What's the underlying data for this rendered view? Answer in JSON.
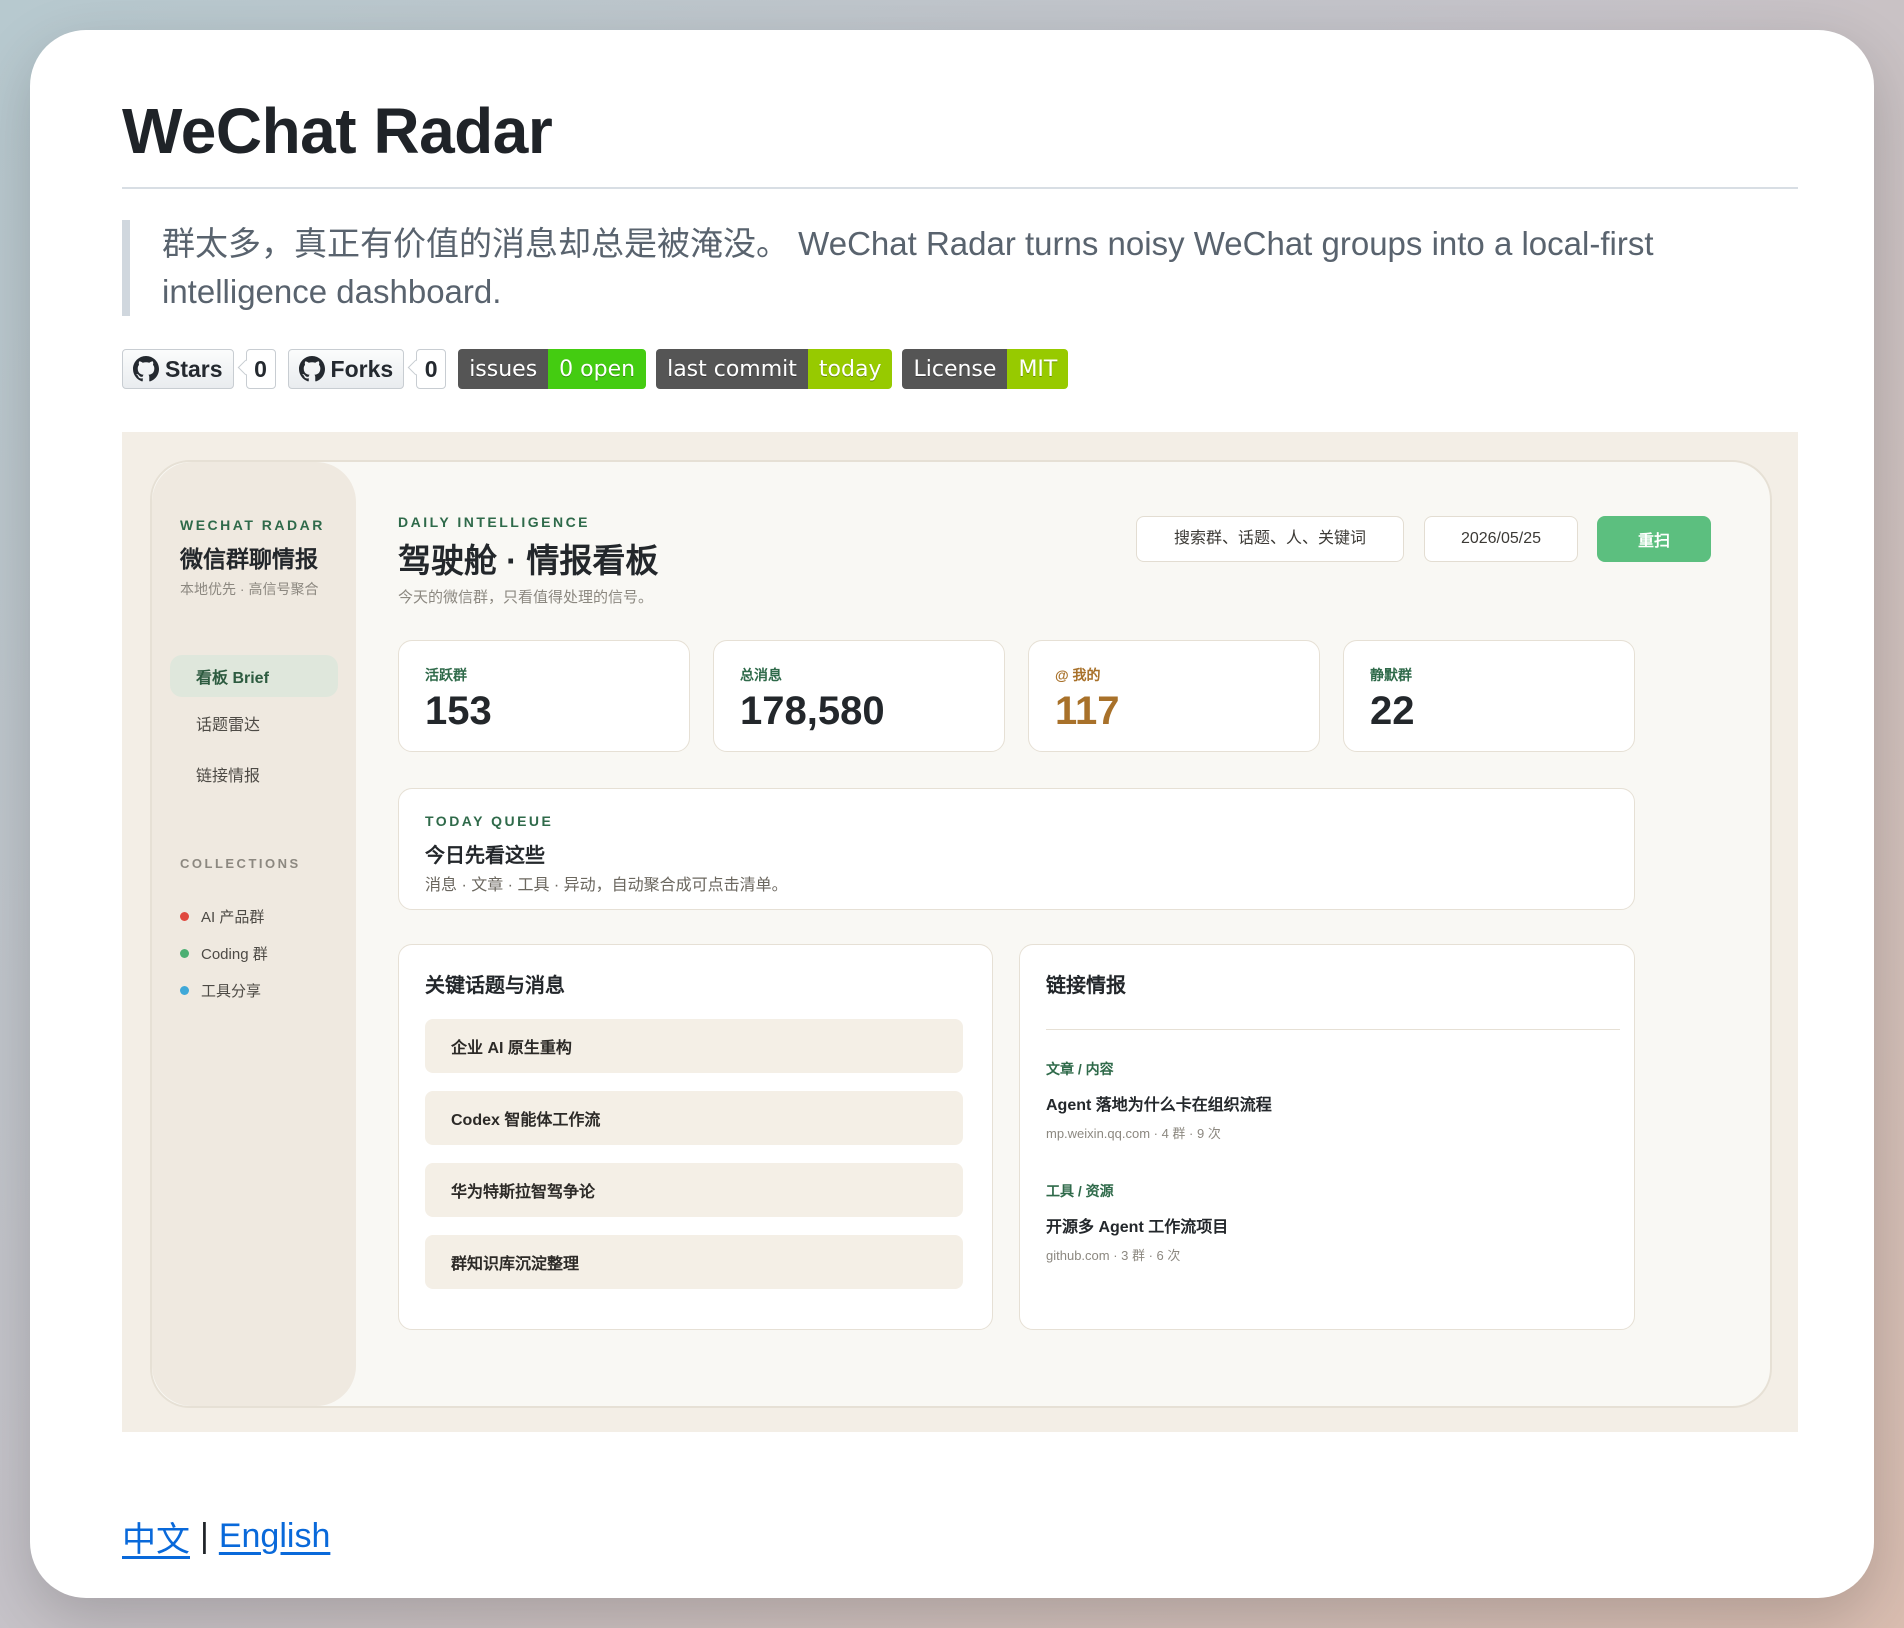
{
  "readme": {
    "title": "WeChat Radar",
    "tagline": "群太多，真正有价值的消息却总是被淹没。 WeChat Radar turns noisy WeChat groups into a local-first intelligence dashboard.",
    "badges": {
      "stars_label": "Stars",
      "stars_count": "0",
      "forks_label": "Forks",
      "forks_count": "0",
      "issues_label": "issues",
      "issues_value": "0 open",
      "commit_label": "last commit",
      "commit_value": "today",
      "license_label": "License",
      "license_value": "MIT"
    },
    "lang_zh": "中文",
    "lang_sep": "|",
    "lang_en": "English"
  },
  "dashboard": {
    "sidebar": {
      "eyebrow": "WECHAT RADAR",
      "title": "微信群聊情报",
      "subtitle": "本地优先 · 高信号聚合",
      "nav": [
        {
          "label": "看板 Brief",
          "active": true
        },
        {
          "label": "话题雷达",
          "active": false
        },
        {
          "label": "链接情报",
          "active": false
        }
      ],
      "collections_heading": "COLLECTIONS",
      "collections": [
        {
          "label": "AI 产品群",
          "color": "#e0483e"
        },
        {
          "label": "Coding 群",
          "color": "#4caf73"
        },
        {
          "label": "工具分享",
          "color": "#3fa8d8"
        }
      ]
    },
    "header": {
      "eyebrow": "DAILY INTELLIGENCE",
      "title": "驾驶舱 · 情报看板",
      "subtitle": "今天的微信群，只看值得处理的信号。",
      "search_placeholder": "搜索群、话题、人、关键词",
      "date": "2026/05/25",
      "rescan_label": "重扫"
    },
    "stats": [
      {
        "label": "活跃群",
        "value": "153"
      },
      {
        "label": "总消息",
        "value": "178,580"
      },
      {
        "label": "@ 我的",
        "value": "117",
        "accent": "#a8712a"
      },
      {
        "label": "静默群",
        "value": "22"
      }
    ],
    "queue": {
      "eyebrow": "TODAY QUEUE",
      "title": "今日先看这些",
      "subtitle": "消息 · 文章 · 工具 · 异动，自动聚合成可点击清单。"
    },
    "topics": {
      "title": "关键话题与消息",
      "items": [
        "企业 AI 原生重构",
        "Codex 智能体工作流",
        "华为特斯拉智驾争论",
        "群知识库沉淀整理"
      ]
    },
    "links": {
      "title": "链接情报",
      "items": [
        {
          "category": "文章 / 内容",
          "title": "Agent 落地为什么卡在组织流程",
          "meta": "mp.weixin.qq.com · 4 群 · 9 次"
        },
        {
          "category": "工具 / 资源",
          "title": "开源多 Agent 工作流项目",
          "meta": "github.com · 3 群 · 6 次"
        }
      ]
    }
  },
  "colors": {
    "accent_green": "#5cbf7f",
    "brand_green": "#2f6a4a",
    "link_blue": "#0969da"
  }
}
